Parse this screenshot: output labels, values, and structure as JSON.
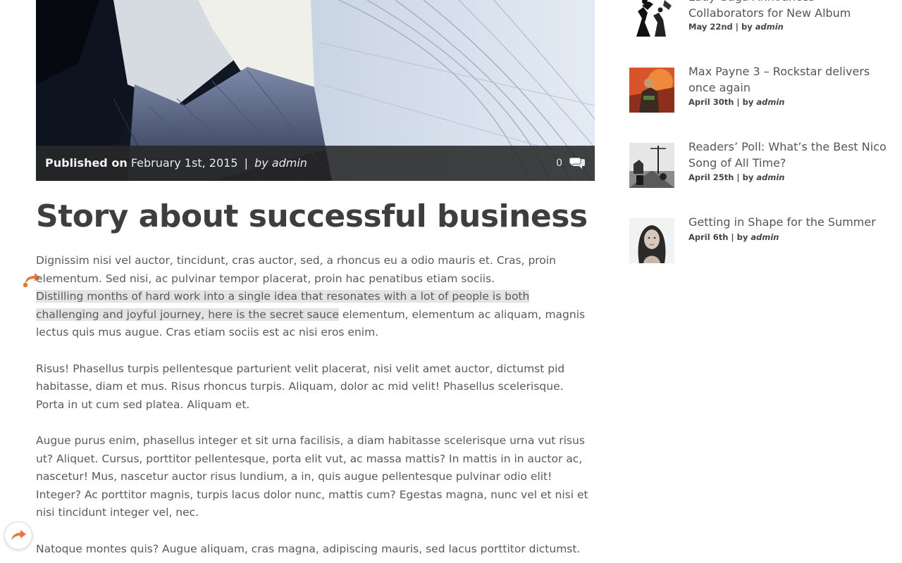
{
  "hero": {
    "published_label": "Published on",
    "date": "February 1st, 2015",
    "separator": "|",
    "by_author": "by admin",
    "comment_count": "0"
  },
  "article": {
    "title": "Story about successful business",
    "p1_start": "Dignissim nisi vel auctor, tincidunt, cras auctor, sed, a rhoncus eu a odio mauris et. Cras, proin elementum. Sed nisi, ac pulvinar tempor placerat, proin hac penatibus etiam sociis.",
    "p1_highlight": "Distilling months of hard work into a single idea that resonates with a lot of people is both challenging and joyful journey, here is the secret sauce",
    "p1_end": " elementum, elementum ac aliquam, magnis lectus quis mus augue. Cras etiam sociis est ac nisi eros enim.",
    "p2": "Risus! Phasellus turpis pellentesque parturient velit placerat, nisi velit amet auctor, dictumst pid habitasse, diam et mus. Risus rhoncus turpis. Aliquam, dolor ac mid velit! Phasellus scelerisque. Porta in ut cum sed platea. Aliquam et.",
    "p3": "Augue purus enim, phasellus integer et sit urna facilisis, a diam habitasse scelerisque urna vut risus ut? Aliquet. Cursus, porttitor pellentesque, porta elit vut, ac massa mattis? In mattis in in auctor ac, nascetur! Mus, nascetur auctor risus lundium, a in, quis augue pellentesque pulvinar odio elit! Integer? Ac porttitor magnis, turpis lacus dolor nunc, mattis cum? Egestas magna, nunc vel et nisi et nisi tincidunt integer vel, nec.",
    "p4": "Natoque montes quis? Augue aliquam, cras magna, adipiscing mauris, sed lacus porttitor dictumst."
  },
  "sidebar": {
    "posts": [
      {
        "title": "Lady Gaga Announces Collaborators for New Album",
        "date": "May 22nd",
        "sep": "| by",
        "author": "admin"
      },
      {
        "title": "Max Payne 3 – Rockstar delivers once again",
        "date": "April 30th",
        "sep": "| by",
        "author": "admin"
      },
      {
        "title": "Readers’ Poll: What’s the Best Nico Song of All Time?",
        "date": "April 25th",
        "sep": "| by",
        "author": "admin"
      },
      {
        "title": "Getting in Shape for the Summer",
        "date": "April 6th",
        "sep": "| by",
        "author": "admin"
      }
    ]
  },
  "colors": {
    "accent_orange": "#e8763a",
    "meta_bar": "#2a2a2a",
    "highlight": "#e3e3e3"
  },
  "icons": [
    "comment-bubble-icon",
    "share-arrow-icon"
  ]
}
